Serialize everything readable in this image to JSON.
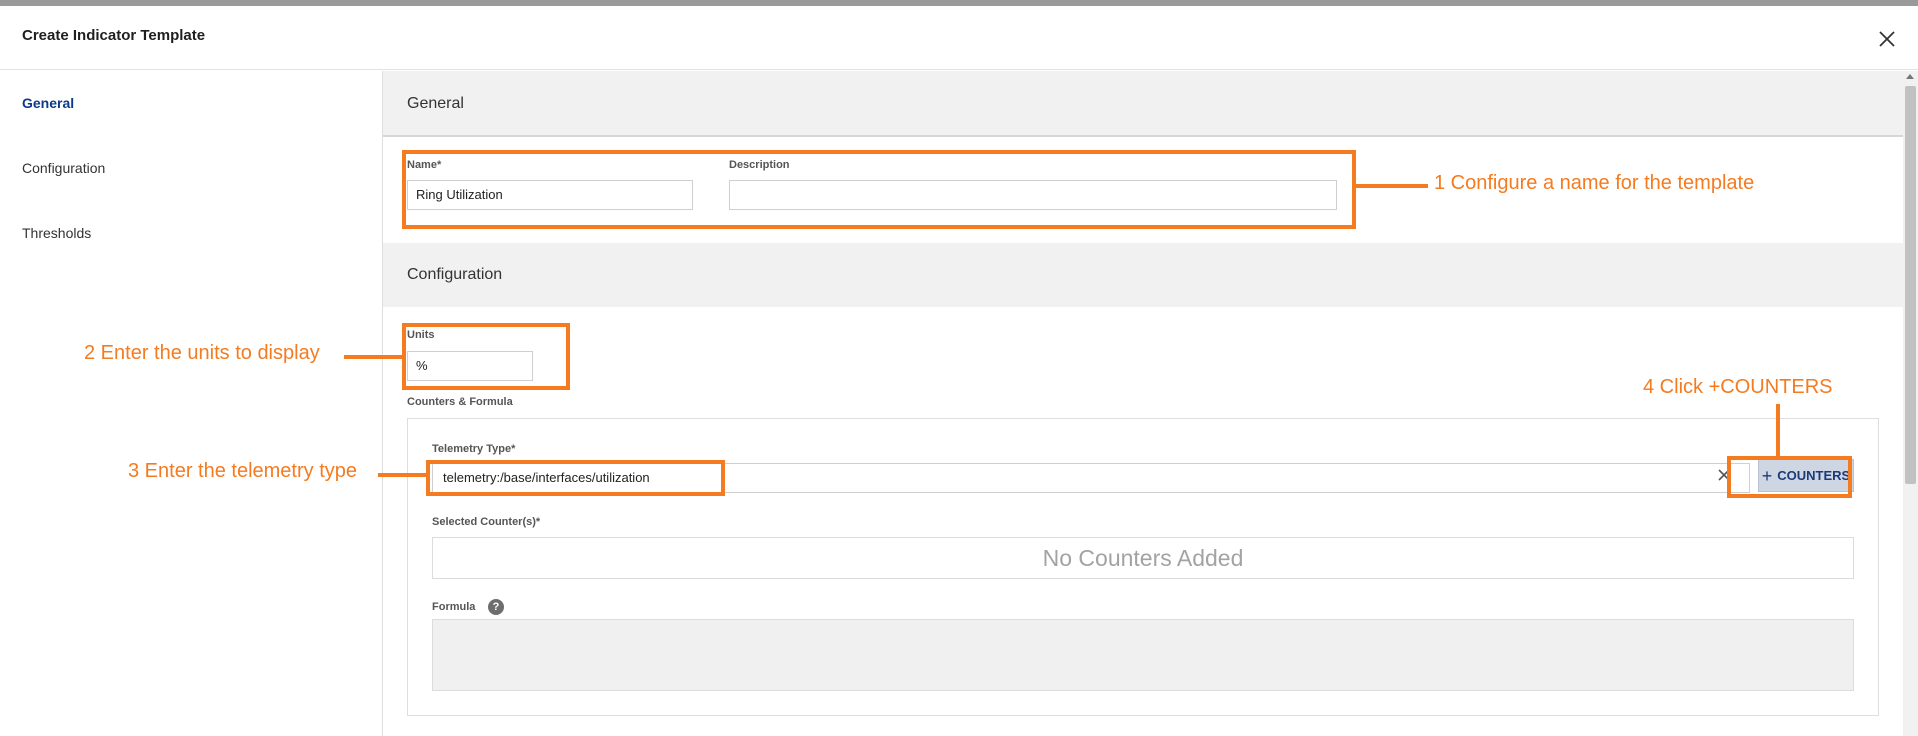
{
  "dialog": {
    "title": "Create Indicator Template"
  },
  "nav": {
    "items": [
      {
        "label": "General",
        "active": true
      },
      {
        "label": "Configuration",
        "active": false
      },
      {
        "label": "Thresholds",
        "active": false
      }
    ]
  },
  "sections": {
    "general": {
      "title": "General",
      "name_label": "Name*",
      "name_value": "Ring Utilization",
      "description_label": "Description",
      "description_value": ""
    },
    "configuration": {
      "title": "Configuration",
      "units_label": "Units",
      "units_value": "%",
      "counters_label": "Counters & Formula",
      "telemetry_label": "Telemetry Type*",
      "telemetry_value": "telemetry:/base/interfaces/utilization",
      "counters_button": "COUNTERS",
      "selected_counters_label": "Selected Counter(s)*",
      "no_counters_text": "No Counters Added",
      "formula_label": "Formula",
      "help_glyph": "?"
    }
  },
  "annotations": {
    "step1": "1 Configure a name for the template",
    "step2": "2 Enter the units to display",
    "step3": "3 Enter the telemetry type",
    "step4": "4 Click +COUNTERS"
  },
  "colors": {
    "annotation": "#f47b20",
    "nav_active": "#0b3a8a",
    "section_header_bg": "#f1f1f1",
    "counters_button_bg": "#cfd6e3"
  },
  "icons": {
    "close": "close-icon",
    "clear": "clear-icon",
    "help": "help-icon",
    "plus": "plus-icon"
  }
}
